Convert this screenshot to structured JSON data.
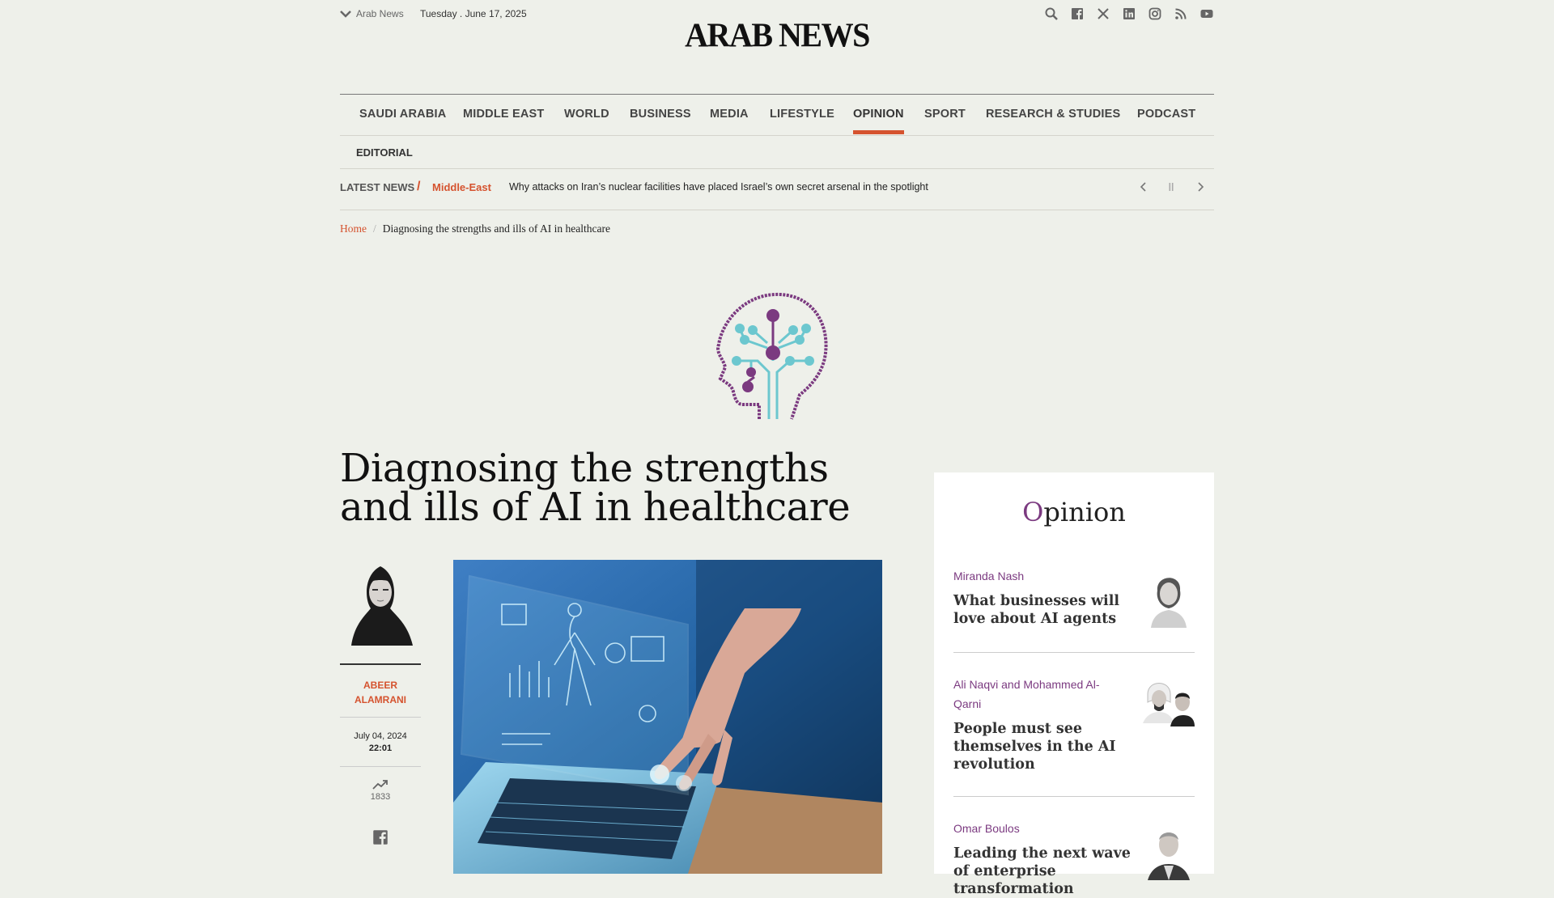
{
  "topbar": {
    "edition": "Arab News",
    "date": "Tuesday .  June 17, 2025",
    "social_icons": [
      "search-icon",
      "facebook-icon",
      "x-icon",
      "linkedin-icon",
      "instagram-icon",
      "rss-icon",
      "youtube-icon"
    ]
  },
  "logo": "ARAB NEWS",
  "nav": {
    "items": [
      "SAUDI ARABIA",
      "MIDDLE EAST",
      "WORLD",
      "BUSINESS",
      "MEDIA",
      "LIFESTYLE",
      "OPINION",
      "SPORT",
      "RESEARCH & STUDIES",
      "PODCAST"
    ],
    "active": "OPINION",
    "sub": "EDITORIAL"
  },
  "ticker": {
    "label": "LATEST NEWS",
    "slash": "/",
    "category": "Middle-East",
    "headline": "Why attacks on Iran’s nuclear facilities have placed Israel’s own secret arsenal in the spotlight"
  },
  "breadcrumb": {
    "home": "Home",
    "sep": "/",
    "current": "Diagnosing the strengths and ills of AI in healthcare"
  },
  "article": {
    "title": "Diagnosing the strengths and ills of AI in healthcare",
    "author_first": "ABEER",
    "author_last": "ALAMRANI",
    "date": "July 04, 2024",
    "time": "22:01",
    "views": "1833"
  },
  "opinion": {
    "heading_first": "O",
    "heading_rest": "pinion",
    "items": [
      {
        "author": "Miranda Nash",
        "headline": "What businesses will love about AI agents"
      },
      {
        "author": "Ali Naqvi and Mohammed Al-Qarni",
        "headline": "People must see themselves in the AI revolution"
      },
      {
        "author": "Omar Boulos",
        "headline": "Leading the next wave of enterprise transformation"
      }
    ]
  },
  "colors": {
    "accent": "#d5532f",
    "opinion": "#7b3a80",
    "background": "#eef0ea"
  }
}
